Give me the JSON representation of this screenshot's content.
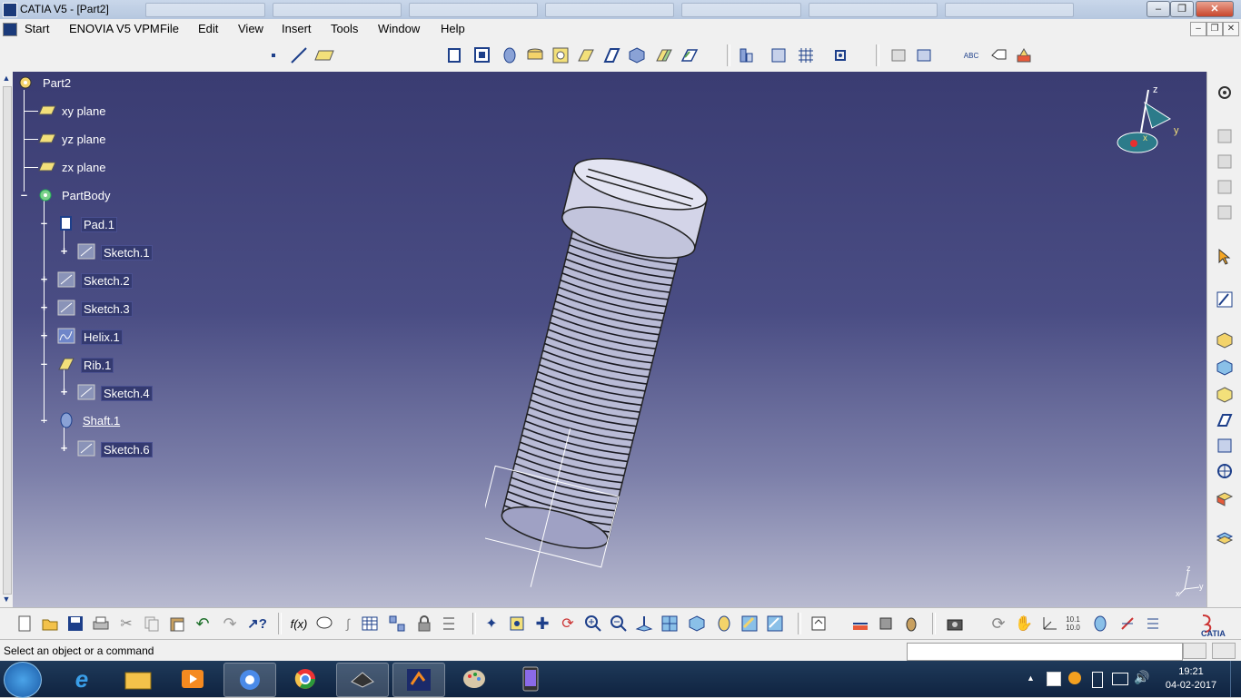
{
  "window": {
    "title": "CATIA V5 - [Part2]"
  },
  "menu": {
    "items": [
      "Start",
      "ENOVIA V5 VPM",
      "File",
      "Edit",
      "View",
      "Insert",
      "Tools",
      "Window",
      "Help"
    ]
  },
  "tree": {
    "root": "Part2",
    "nodes": [
      {
        "label": "xy plane"
      },
      {
        "label": "yz plane"
      },
      {
        "label": "zx plane"
      },
      {
        "label": "PartBody"
      },
      {
        "label": "Pad.1"
      },
      {
        "label": "Sketch.1"
      },
      {
        "label": "Sketch.2"
      },
      {
        "label": "Sketch.3"
      },
      {
        "label": "Helix.1"
      },
      {
        "label": "Rib.1"
      },
      {
        "label": "Sketch.4"
      },
      {
        "label": "Shaft.1"
      },
      {
        "label": "Sketch.6"
      }
    ]
  },
  "compass": {
    "z": "z",
    "y": "y",
    "x": "x"
  },
  "triad": {
    "z": "z",
    "x": "x",
    "y": "y"
  },
  "status": {
    "message": "Select an object or a command",
    "command_value": ""
  },
  "toolbar_icons": {
    "bottom": [
      "new",
      "open",
      "save",
      "print",
      "cut",
      "copy",
      "paste",
      "undo",
      "redo",
      "whats-this"
    ]
  },
  "taskbar": {
    "time": "19:21",
    "date": "04-02-2017"
  },
  "colors": {
    "background_top": "#3a3c72",
    "background_bottom": "#b8bad0",
    "part": "#c8c9e0",
    "accent": "#1d3f8a"
  }
}
